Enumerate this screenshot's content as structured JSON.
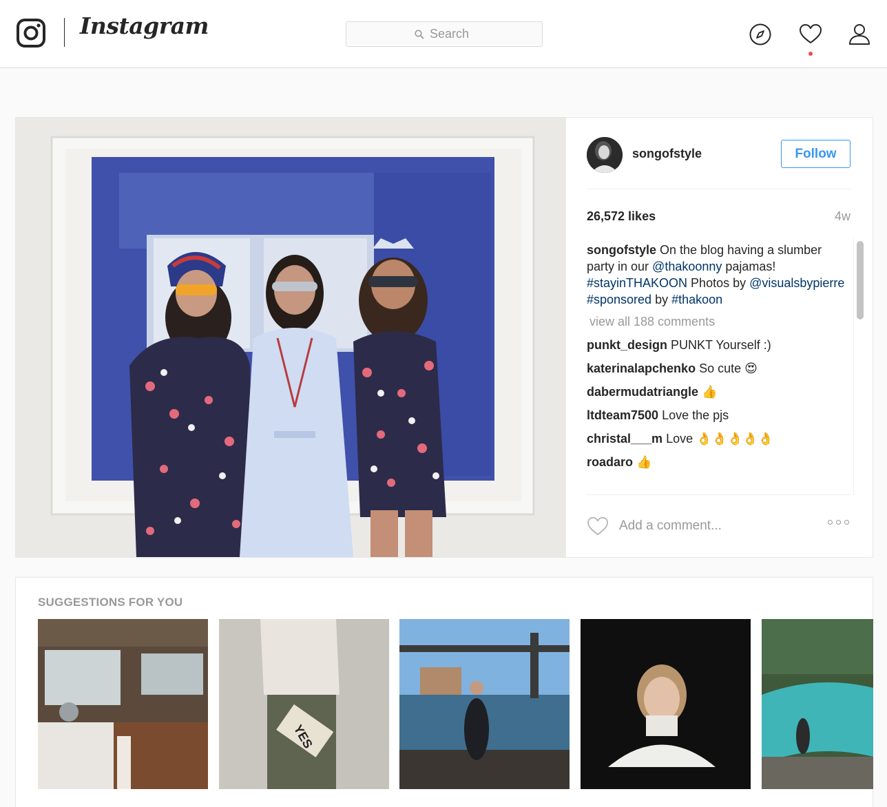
{
  "header": {
    "wordmark": "Instagram",
    "search_placeholder": "Search",
    "icons": [
      "instagram-logo-icon",
      "search-icon",
      "compass-icon",
      "heart-icon",
      "person-icon"
    ],
    "notification_dot_color": "#ed4956"
  },
  "post": {
    "username": "songofstyle",
    "follow_label": "Follow",
    "likes": "26,572 likes",
    "time_ago": "4w",
    "caption": {
      "username": "songofstyle",
      "text_1": " On the blog having a slumber party in our ",
      "mention_1": "@thakoonny",
      "text_2": " pajamas! ",
      "hashtag_1": "#stayinTHAKOON",
      "text_3": " Photos by ",
      "mention_2": "@visualsbypierre",
      "hashtag_2": "#sponsored",
      "text_4": " by ",
      "hashtag_3": "#thakoon"
    },
    "view_all_comments": "view all 188 comments",
    "comments": [
      {
        "username": "punkt_design",
        "text": " PUNKT Yourself :)",
        "emoji": ""
      },
      {
        "username": "katerinalapchenko",
        "text": " So cute ",
        "emoji": "😍"
      },
      {
        "username": "dabermudatriangle",
        "text": " ",
        "emoji": "👍"
      },
      {
        "username": "ltdteam7500",
        "text": " Love the pjs",
        "emoji": ""
      },
      {
        "username": "christal___m",
        "text": " Love ",
        "emoji": "👌👌👌👌👌"
      },
      {
        "username": "roadaro",
        "text": " ",
        "emoji": "👍"
      }
    ],
    "add_comment_placeholder": "Add a comment...",
    "link_color": "#003569",
    "accent_color": "#3897f0"
  },
  "suggestions": {
    "title": "SUGGESTIONS FOR YOU",
    "tiles": [
      "suggestion-camper-kitchen",
      "suggestion-yes-pouch",
      "suggestion-bridge-river",
      "suggestion-white-sweater-portrait",
      "suggestion-turquoise-river"
    ]
  }
}
